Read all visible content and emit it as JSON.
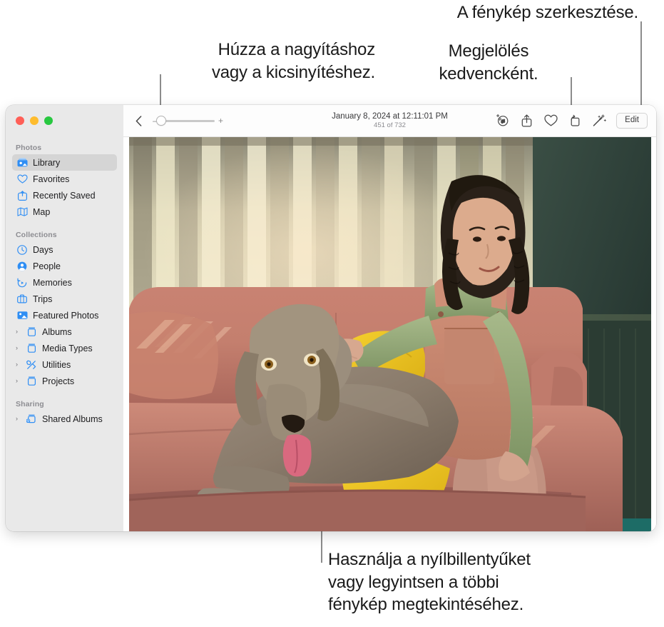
{
  "annotations": [
    {
      "id": "zoom",
      "text": "Húzza a nagyításhoz\nvagy a kicsinyítéshez."
    },
    {
      "id": "edit",
      "text": "A fénykép szerkesztése."
    },
    {
      "id": "favorite",
      "text": "Megjelölés\nkedvencként."
    },
    {
      "id": "arrows",
      "text": "Használja a nyílbillentyűket\nvagy legyintsen a többi\nfénykép megtekintéséhez."
    }
  ],
  "window": {
    "traffic_lights": [
      "close",
      "minimize",
      "zoom"
    ],
    "colors": {
      "close": "#ff5f57",
      "minimize": "#febc2e",
      "maximize": "#28c840",
      "accent": "#007aff",
      "sidebar_bg": "#e9e9e9",
      "selected_bg": "#d5d5d5"
    }
  },
  "sidebar": {
    "groups": [
      {
        "header": "Photos",
        "items": [
          {
            "label": "Library",
            "icon": "photos-library-icon",
            "selected": true,
            "disclosure": false
          },
          {
            "label": "Favorites",
            "icon": "heart-icon",
            "selected": false,
            "disclosure": false
          },
          {
            "label": "Recently Saved",
            "icon": "recently-saved-icon",
            "selected": false,
            "disclosure": false
          },
          {
            "label": "Map",
            "icon": "map-icon",
            "selected": false,
            "disclosure": false
          }
        ]
      },
      {
        "header": "Collections",
        "items": [
          {
            "label": "Days",
            "icon": "clock-icon",
            "selected": false,
            "disclosure": false
          },
          {
            "label": "People",
            "icon": "person-circle-icon",
            "selected": false,
            "disclosure": false
          },
          {
            "label": "Memories",
            "icon": "memories-play-icon",
            "selected": false,
            "disclosure": false
          },
          {
            "label": "Trips",
            "icon": "suitcase-icon",
            "selected": false,
            "disclosure": false
          },
          {
            "label": "Featured Photos",
            "icon": "featured-photo-icon",
            "selected": false,
            "disclosure": false
          },
          {
            "label": "Albums",
            "icon": "album-icon",
            "selected": false,
            "disclosure": true
          },
          {
            "label": "Media Types",
            "icon": "album-icon",
            "selected": false,
            "disclosure": true
          },
          {
            "label": "Utilities",
            "icon": "tools-icon",
            "selected": false,
            "disclosure": true
          },
          {
            "label": "Projects",
            "icon": "album-icon",
            "selected": false,
            "disclosure": true
          }
        ]
      },
      {
        "header": "Sharing",
        "items": [
          {
            "label": "Shared Albums",
            "icon": "shared-album-icon",
            "selected": false,
            "disclosure": true
          }
        ]
      }
    ]
  },
  "toolbar": {
    "back_icon": "chevron-left-icon",
    "zoom": {
      "minus": "–",
      "plus": "+",
      "value": 0
    },
    "title": "January 8, 2024 at 12:11:01 PM",
    "subtitle": "451 of 732",
    "actions": [
      {
        "name": "visual-look-up-icon",
        "label": "Info"
      },
      {
        "name": "share-icon",
        "label": "Share"
      },
      {
        "name": "heart-icon",
        "label": "Favorite"
      },
      {
        "name": "rotate-icon",
        "label": "Rotate"
      },
      {
        "name": "auto-enhance-icon",
        "label": "Auto Enhance"
      }
    ],
    "edit_label": "Edit"
  },
  "photo": {
    "description": "Girl in pink corduroy overalls and green top petting a Weimaraner dog on a pink velvet sofa",
    "alt": "Photo of a girl and a dog on a couch"
  }
}
